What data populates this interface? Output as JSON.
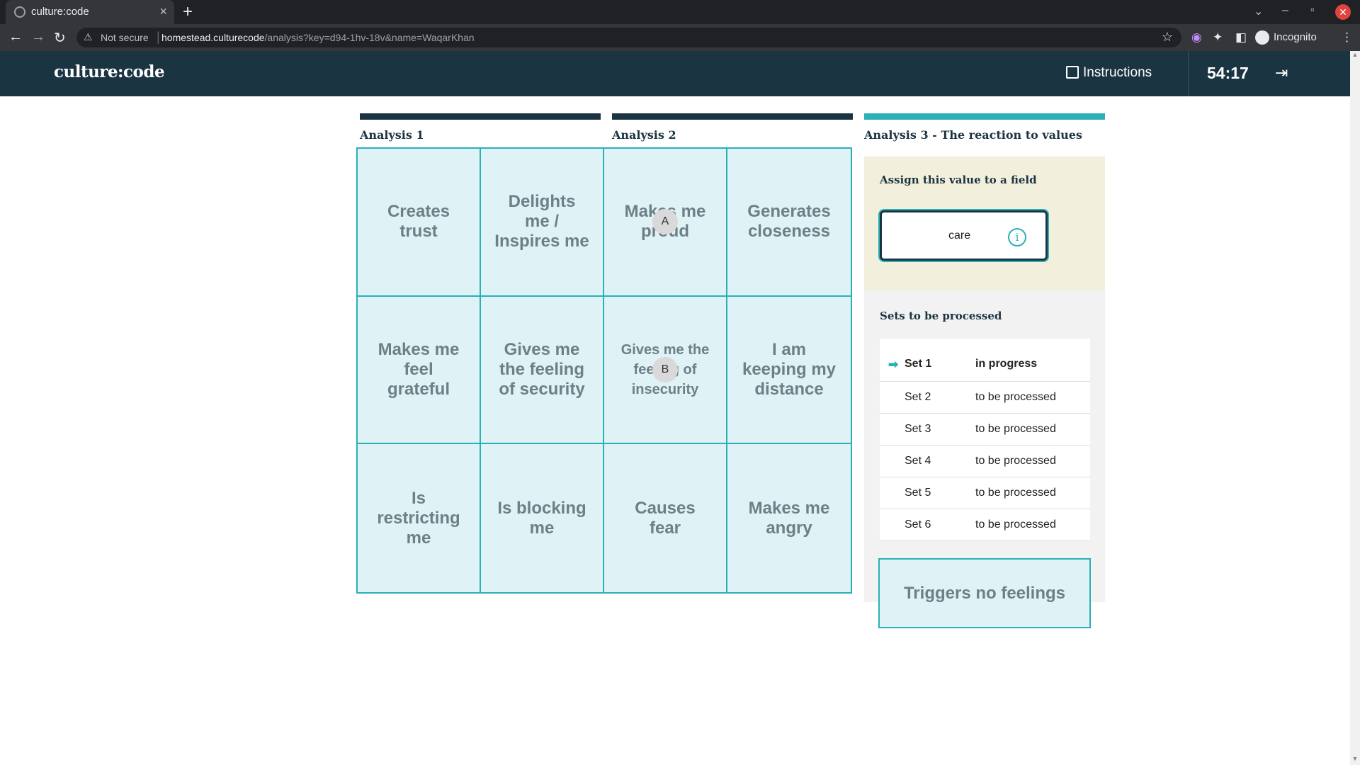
{
  "browser": {
    "tab_title": "culture:code",
    "tab_close": "×",
    "new_tab": "+",
    "security": "Not secure",
    "url_host": "homestead.culturecode",
    "url_path": "/analysis?key=d94-1hv-18v&name=WaqarKhan",
    "profile": "Incognito",
    "back": "←",
    "forward": "→",
    "reload": "↻",
    "star": "☆"
  },
  "header": {
    "logo": "culture:code",
    "instructions_label": "Instructions",
    "timer": "54:17",
    "logout_icon": "⇥"
  },
  "analyses": [
    {
      "label": "Analysis 1",
      "color": "#1b3442"
    },
    {
      "label": "Analysis 2",
      "color": "#1b3442"
    },
    {
      "label": "Analysis 3 - The reaction to values",
      "color": "#2bb0b8"
    }
  ],
  "grid": {
    "cells": [
      {
        "label": "Creates trust",
        "marker": ""
      },
      {
        "label": "Delights me / Inspires me",
        "marker": ""
      },
      {
        "label": "Makes me proud",
        "marker": "A"
      },
      {
        "label": "Generates closeness",
        "marker": ""
      },
      {
        "label": "Makes me feel grateful",
        "marker": ""
      },
      {
        "label": "Gives me the feeling of security",
        "marker": ""
      },
      {
        "label": "Gives me the feeling of insecurity",
        "marker": "B"
      },
      {
        "label": "I am keeping my distance",
        "marker": ""
      },
      {
        "label": "Is restricting me",
        "marker": ""
      },
      {
        "label": "Is blocking me",
        "marker": ""
      },
      {
        "label": "Causes fear",
        "marker": ""
      },
      {
        "label": "Makes me angry",
        "marker": ""
      }
    ]
  },
  "assign": {
    "title": "Assign this value to a field",
    "value": "care",
    "info_icon": "i"
  },
  "sets": {
    "title": "Sets to be processed",
    "rows": [
      {
        "name": "Set 1",
        "status": "in progress",
        "active": true
      },
      {
        "name": "Set 2",
        "status": "to be processed",
        "active": false
      },
      {
        "name": "Set 3",
        "status": "to be processed",
        "active": false
      },
      {
        "name": "Set 4",
        "status": "to be processed",
        "active": false
      },
      {
        "name": "Set 5",
        "status": "to be processed",
        "active": false
      },
      {
        "name": "Set 6",
        "status": "to be processed",
        "active": false
      }
    ]
  },
  "no_feelings": "Triggers no feelings"
}
